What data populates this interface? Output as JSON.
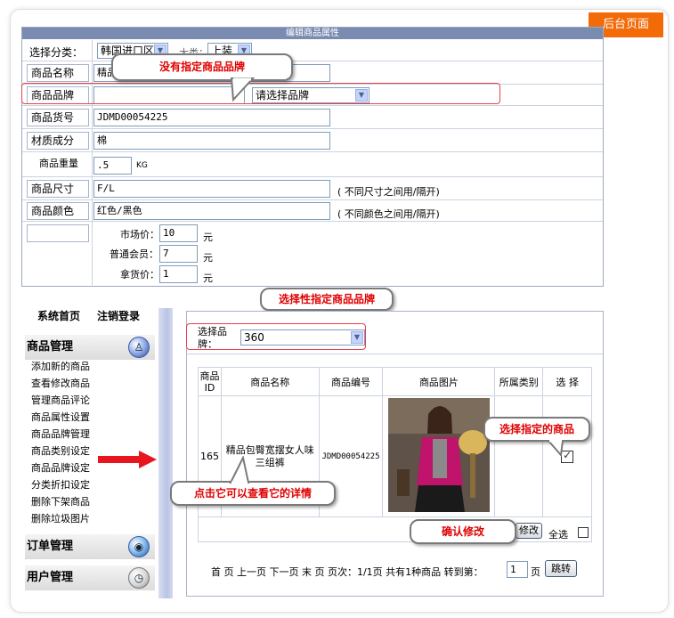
{
  "badge": "后台页面",
  "form": {
    "title": "编辑商品属性",
    "category_label": "选择分类：",
    "category_value": "韩国进口区",
    "subtype_label": "大类：",
    "subtype_value": "上装",
    "name_label": "商品名称",
    "name_value": "精品包臀宽摆女人味三组裤",
    "brand_label": "商品品牌",
    "brand_input": "",
    "brand_select": "请选择品牌",
    "sku_label": "商品货号",
    "sku_value": "JDMD00054225",
    "material_label": "材质成分",
    "material_value": "棉",
    "weight_label": "商品重量",
    "weight_value": ".5",
    "weight_unit": "KG",
    "size_label": "商品尺寸",
    "size_value": "F/L",
    "size_hint": "( 不同尺寸之间用/隔开)",
    "color_label": "商品颜色",
    "color_value": "红色/黑色",
    "color_hint": "( 不同颜色之间用/隔开)",
    "market_label": "市场价：",
    "market_value": "10",
    "member_label": "普通会员：",
    "member_value": "7",
    "wholesale_label": "拿货价：",
    "wholesale_value": "1",
    "yuan": "元"
  },
  "callouts": {
    "no_brand": "没有指定商品品牌",
    "optional_brand": "选择性指定商品品牌",
    "click_detail": "点击它可以查看它的详情",
    "select_product": "选择指定的商品",
    "confirm": "确认修改"
  },
  "sidebar": {
    "top_home": "系统首页",
    "top_logout": "注销登录",
    "group_products": "商品管理",
    "items": [
      "添加新的商品",
      "查看修改商品",
      "管理商品评论",
      "商品属性设置",
      "商品品牌管理",
      "商品类别设定",
      "商品品牌设定",
      "分类折扣设定",
      "删除下架商品",
      "删除垃圾图片"
    ],
    "group_orders": "订单管理",
    "group_users": "用户管理"
  },
  "panel": {
    "brand_label": "选择品牌：",
    "brand_value": "360",
    "headers": [
      "商品ID",
      "商品名称",
      "商品编号",
      "商品图片",
      "所属类别",
      "选 择"
    ],
    "row": {
      "id": "165",
      "name": "精品包臀宽摆女人味三组裤",
      "code": "JDMD00054225",
      "image": "woman-in-magenta-cardigan",
      "category": ""
    },
    "modify_button": "修改",
    "select_all": "全选",
    "pager": "首 页  上一页  下一页  末 页  页次：1/1页  共有1种商品  转到第：",
    "page_value": "1",
    "page_unit": "页",
    "jump_button": "跳转"
  }
}
